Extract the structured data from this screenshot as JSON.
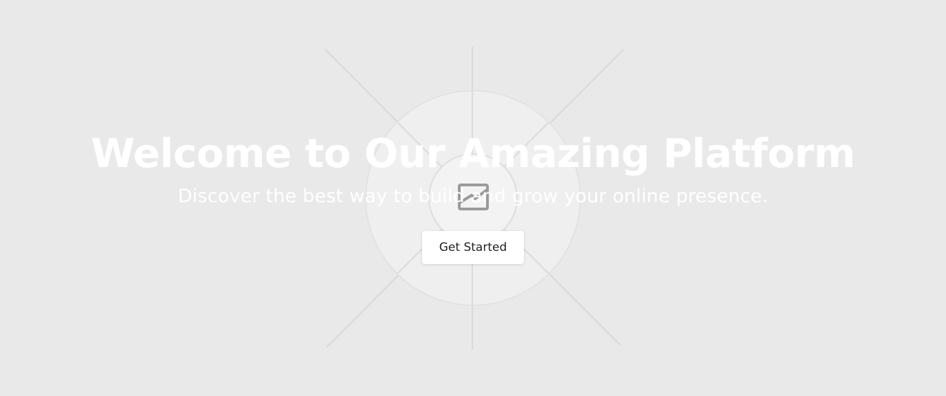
{
  "hero": {
    "title": "Welcome to Our Amazing Platform",
    "subtitle": "Discover the best way to build and grow your online presence.",
    "cta_label": "Get Started"
  },
  "background": {
    "placeholder_icon": "image-placeholder-icon"
  },
  "colors": {
    "page_bg": "#e9e9e9",
    "text": "#ffffff",
    "button_bg": "#ffffff",
    "button_text": "#1f1f1f"
  }
}
